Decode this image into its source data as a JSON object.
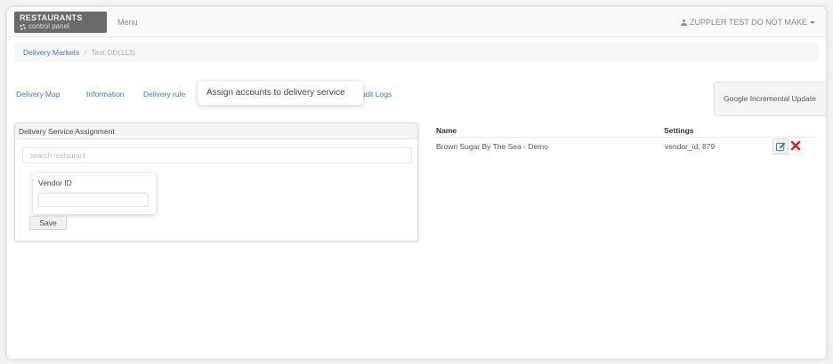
{
  "navbar": {
    "brand_title": "RESTAURANTS",
    "brand_subtitle": "control panel",
    "menu_label": "Menu",
    "user_label": "ZUPPLER TEST DO NOT MAKE"
  },
  "breadcrumb": {
    "root": "Delivery Markets",
    "separator": "/",
    "current": "Test DD(113)"
  },
  "tabs": [
    {
      "label": "Delivery Map"
    },
    {
      "label": "Information"
    },
    {
      "label": "Delivery rule"
    },
    {
      "label": "Assign accounts to delivery service"
    },
    {
      "label": "Audit Logs"
    }
  ],
  "google_button_label": "Google Incremental Update",
  "assignment_panel": {
    "heading": "Delivery Service Assignment",
    "search_placeholder": "search restaurant",
    "vendor_id_label": "Vendor ID",
    "vendor_id_value": "",
    "save_label": "Save"
  },
  "table": {
    "headers": {
      "name": "Name",
      "settings": "Settings"
    },
    "rows": [
      {
        "name": "Brown Sugar By The Sea - Demo",
        "settings": "vendor_id; 879"
      }
    ]
  },
  "colors": {
    "link": "#3b7bbf",
    "brand_bg": "#6a6a6a",
    "edit_icon": "#3a6fd8",
    "delete_icon": "#e02020"
  },
  "icons": [
    "gear-icon",
    "user-icon",
    "caret-down-icon",
    "edit-icon",
    "delete-icon"
  ]
}
